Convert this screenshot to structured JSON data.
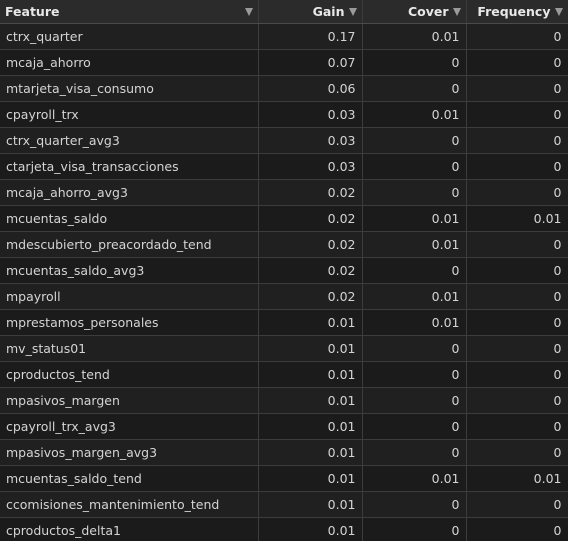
{
  "table": {
    "columns": [
      {
        "label": "Feature",
        "icon": "sort-icon"
      },
      {
        "label": "Gain",
        "icon": "sort-icon"
      },
      {
        "label": "Cover",
        "icon": "sort-icon"
      },
      {
        "label": "Frequency",
        "icon": "sort-icon"
      }
    ],
    "rows": [
      [
        "ctrx_quarter",
        "0.17",
        "0.01",
        "0"
      ],
      [
        "mcaja_ahorro",
        "0.07",
        "0",
        "0"
      ],
      [
        "mtarjeta_visa_consumo",
        "0.06",
        "0",
        "0"
      ],
      [
        "cpayroll_trx",
        "0.03",
        "0.01",
        "0"
      ],
      [
        "ctrx_quarter_avg3",
        "0.03",
        "0",
        "0"
      ],
      [
        "ctarjeta_visa_transacciones",
        "0.03",
        "0",
        "0"
      ],
      [
        "mcaja_ahorro_avg3",
        "0.02",
        "0",
        "0"
      ],
      [
        "mcuentas_saldo",
        "0.02",
        "0.01",
        "0.01"
      ],
      [
        "mdescubierto_preacordado_tend",
        "0.02",
        "0.01",
        "0"
      ],
      [
        "mcuentas_saldo_avg3",
        "0.02",
        "0",
        "0"
      ],
      [
        "mpayroll",
        "0.02",
        "0.01",
        "0"
      ],
      [
        "mprestamos_personales",
        "0.01",
        "0.01",
        "0"
      ],
      [
        "mv_status01",
        "0.01",
        "0",
        "0"
      ],
      [
        "cproductos_tend",
        "0.01",
        "0",
        "0"
      ],
      [
        "mpasivos_margen",
        "0.01",
        "0",
        "0"
      ],
      [
        "cpayroll_trx_avg3",
        "0.01",
        "0",
        "0"
      ],
      [
        "mpasivos_margen_avg3",
        "0.01",
        "0",
        "0"
      ],
      [
        "mcuentas_saldo_tend",
        "0.01",
        "0.01",
        "0.01"
      ],
      [
        "ccomisiones_mantenimiento_tend",
        "0.01",
        "0",
        "0"
      ],
      [
        "cproductos_delta1",
        "0.01",
        "0",
        "0"
      ]
    ]
  }
}
